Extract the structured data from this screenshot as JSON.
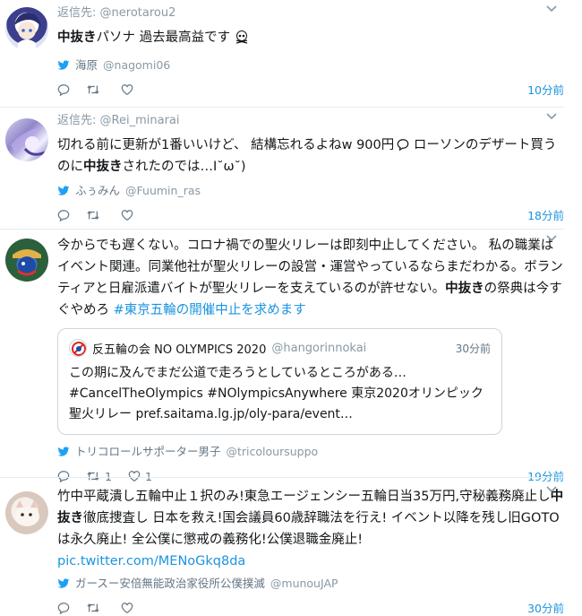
{
  "reply_prefix": "返信先:",
  "tweets": [
    {
      "reply_to": "@nerotarou2",
      "text_parts": [
        {
          "t": "中抜き",
          "b": true
        },
        {
          "t": "パソナ 過去最高益です",
          "b": false
        }
      ],
      "via_name": "海原",
      "via_handle": "@nagomi06",
      "retweets": "",
      "likes": "",
      "time": "10分前"
    },
    {
      "reply_to": "@Rei_minarai",
      "text_parts": [
        {
          "t": "切れる前に更新が1番いいけど、 結構忘れるよねw 900円",
          "b": false
        },
        {
          "t": " ローソンのデザート買うのに",
          "b": false
        },
        {
          "t": "中抜き",
          "b": true
        },
        {
          "t": "されたのでは…I˘ω˘)",
          "b": false
        }
      ],
      "via_name": "ふぅみん",
      "via_handle": "@Fuumin_ras",
      "retweets": "",
      "likes": "",
      "time": "18分前"
    },
    {
      "reply_to": "",
      "text_parts": [
        {
          "t": "今からでも遅くない。コロナ禍での聖火リレーは即刻中止してください。 私の職業はイベント関連。同業他社が聖火リレーの設営・運営やっているならまだわかる。ボランティアと日雇派遣バイトが聖火リレーを支えているのが許せない。",
          "b": false
        },
        {
          "t": "中抜き",
          "b": true
        },
        {
          "t": "の祭典は今すぐやめろ ",
          "b": false
        }
      ],
      "hashtag": "#東京五輪の開催中止を求めます",
      "quote": {
        "name": "反五輪の会 NO OLYMPICS 2020",
        "handle": "@hangorinnokai",
        "time": "30分前",
        "text": "この期に及んでまだ公道で走ろうとしているところがある…#CancelTheOlympics #NOlympicsAnywhere 東京2020オリンピック聖火リレー pref.saitama.lg.jp/oly-para/event…"
      },
      "via_name": "トリコロールサポーター男子",
      "via_handle": "@tricoloursuppo",
      "retweets": "1",
      "likes": "1",
      "time": "19分前"
    },
    {
      "reply_to": "",
      "text_parts": [
        {
          "t": "竹中平蔵潰し五輪中止１択のみ!東急エージェンシー五輪日当35万円,守秘義務廃止し",
          "b": false
        },
        {
          "t": "中抜き",
          "b": true
        },
        {
          "t": "徹底捜査し 日本を救え!国会議員60歳辞職法を行え! イベント以降を残し旧GOTOは永久廃止! 全公僕に懲戒の義務化!公僕退職金廃止!",
          "b": false
        }
      ],
      "link": "pic.twitter.com/MENoGkq8da",
      "via_name": "ガースー安倍無能政治家役所公僕撲滅",
      "via_handle": "@munouJAP",
      "retweets": "",
      "likes": "",
      "time": "30分前"
    }
  ],
  "colors": {
    "link_blue": "#1b95e0",
    "muted": "#8899a6",
    "text": "#14171a",
    "separator": "#e6ecf0"
  },
  "icons": [
    "chevron-down-icon",
    "twitter-bird-icon",
    "reply-icon",
    "retweet-icon",
    "like-icon",
    "speech-bubble-icon",
    "skull-emoji-icon"
  ]
}
